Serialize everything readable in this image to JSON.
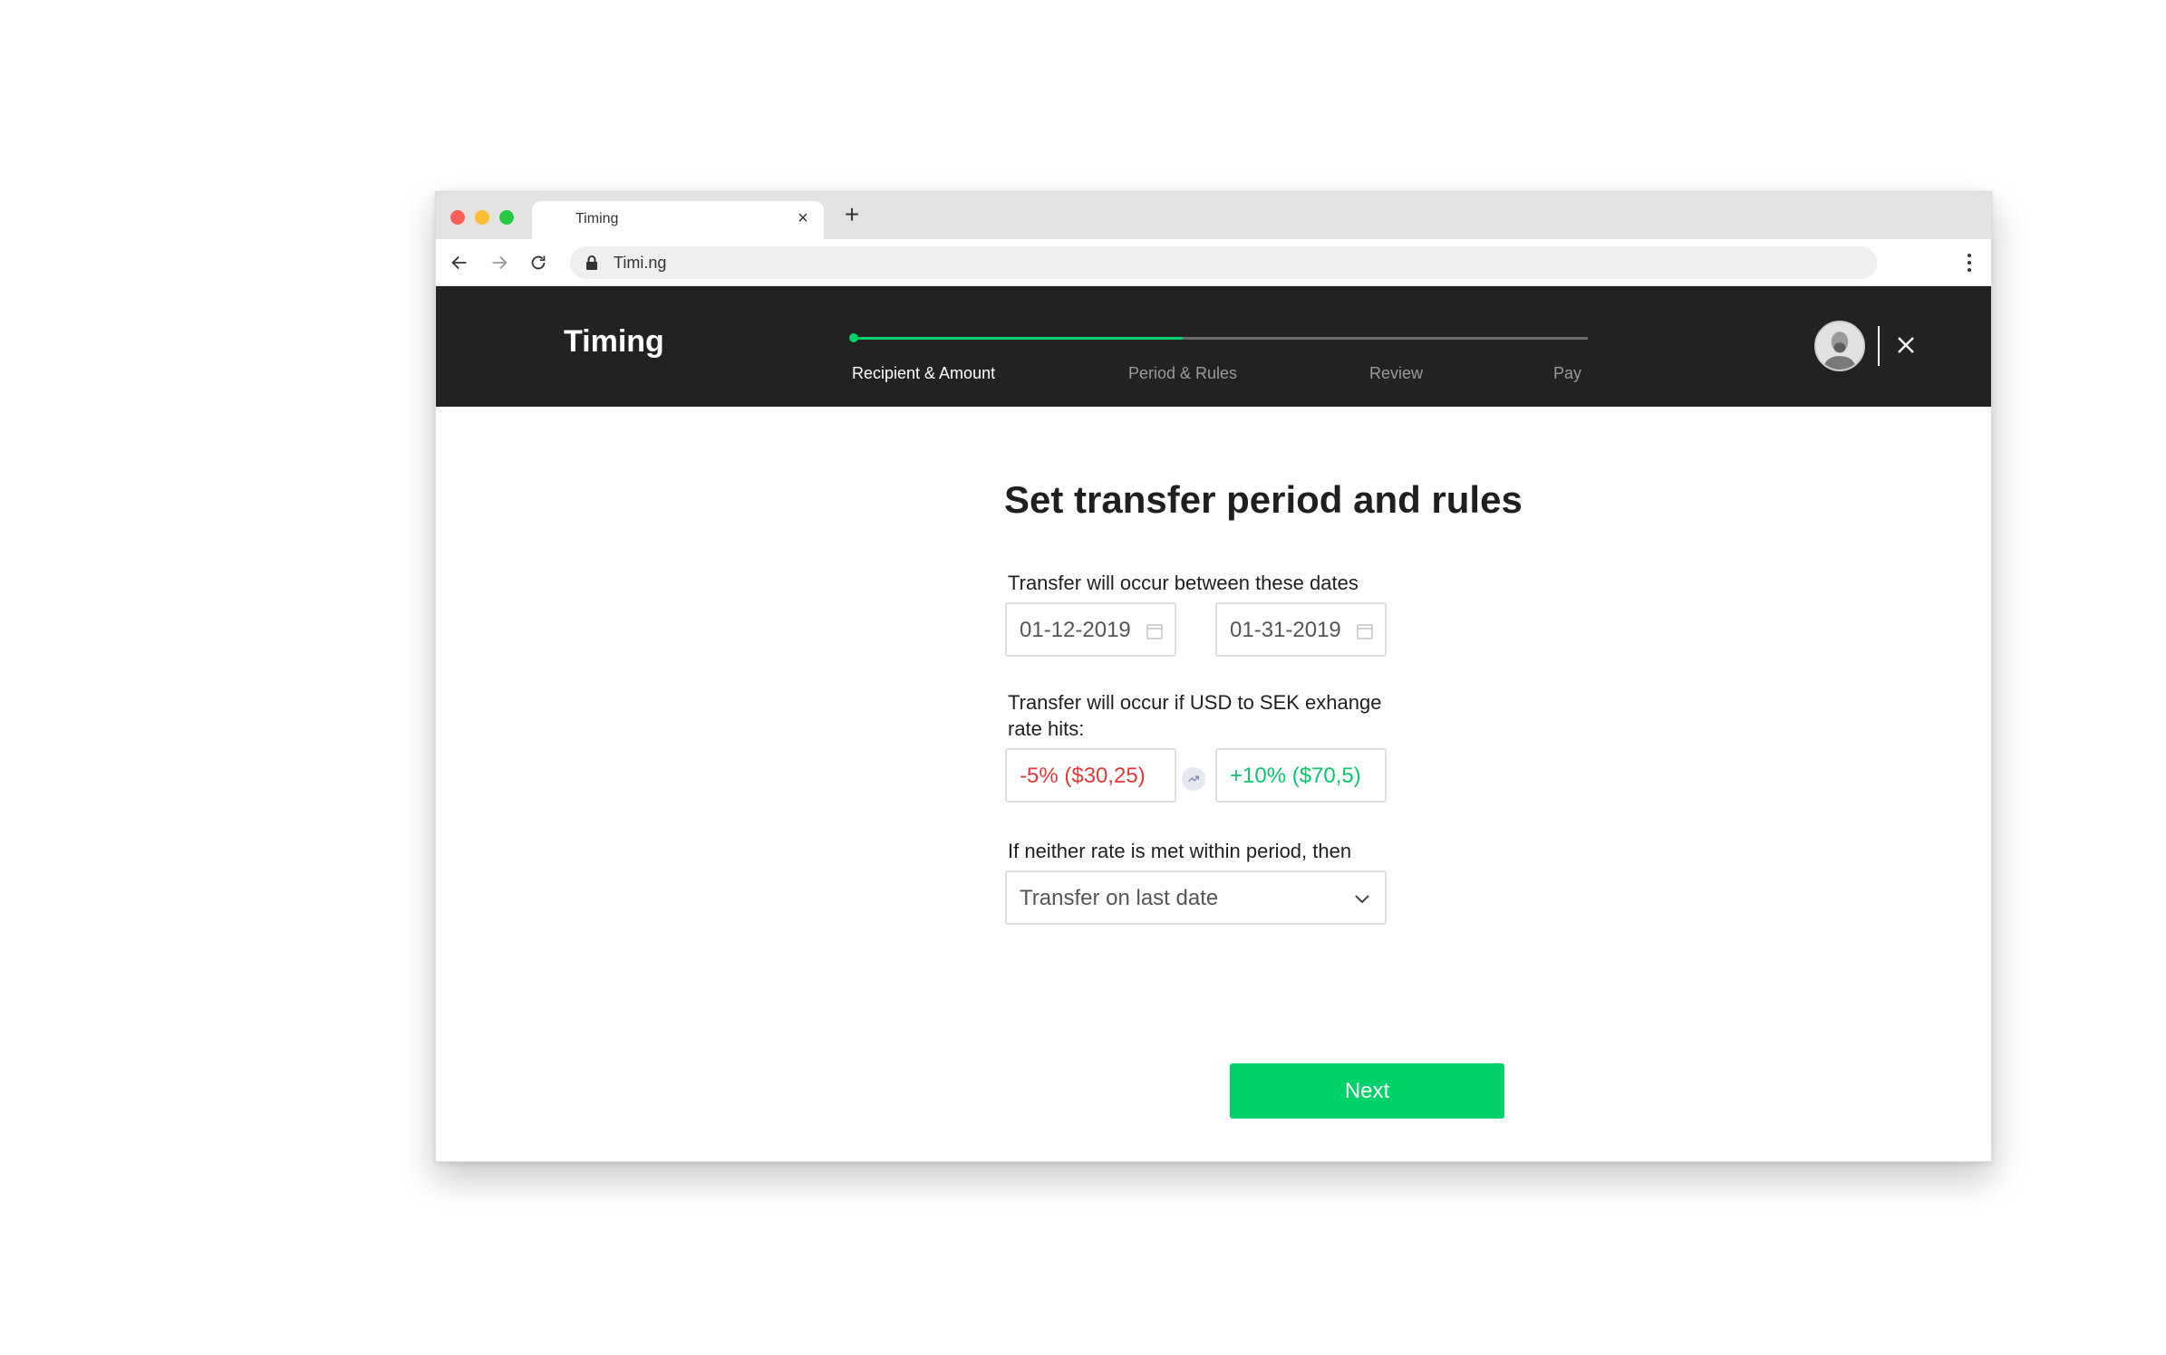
{
  "browser": {
    "tab_title": "Timing",
    "tab_close": "×",
    "new_tab": "+",
    "url": "Timi.ng"
  },
  "app": {
    "brand": "Timing",
    "progress_percent": 45,
    "steps": [
      {
        "label": "Recipient & Amount",
        "active": true
      },
      {
        "label": "Period & Rules",
        "active": false
      },
      {
        "label": "Review",
        "active": false
      },
      {
        "label": "Pay",
        "active": false
      }
    ]
  },
  "form": {
    "title": "Set transfer period and rules",
    "dates_label": "Transfer will occur between these dates",
    "start_date": "01-12-2019",
    "end_date": "01-31-2019",
    "rate_label_line1": "Transfer will occur if USD to SEK exhange",
    "rate_label_line2": "rate hits:",
    "rate_low": "-5% ($30,25)",
    "rate_high": "+10% ($70,5)",
    "fallback_label": "If neither rate is met within period, then",
    "fallback_value": "Transfer on last date",
    "next_label": "Next"
  },
  "colors": {
    "accent": "#00d26a",
    "header_bg": "#222222",
    "negative": "#e23b3b",
    "positive": "#10c46a"
  },
  "icons": {
    "calendar": "calendar-icon",
    "trend": "trend-icon",
    "chevron": "chevron-down-icon",
    "close": "close-icon",
    "lock": "lock-icon"
  }
}
